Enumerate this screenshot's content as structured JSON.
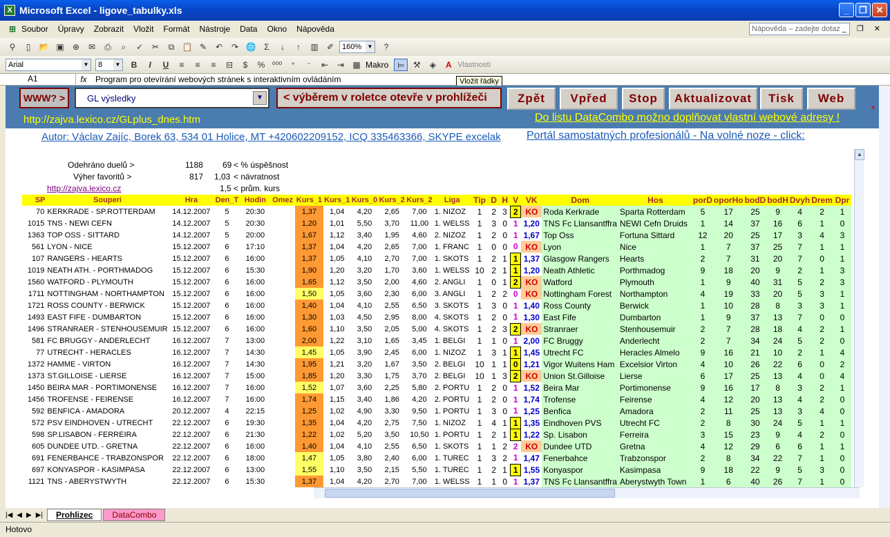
{
  "window": {
    "title": "Microsoft Excel - ligove_tabulky.xls",
    "icon": "excel-icon"
  },
  "menu": [
    "Soubor",
    "Úpravy",
    "Zobrazit",
    "Vložit",
    "Formát",
    "Nástroje",
    "Data",
    "Okno",
    "Nápověda"
  ],
  "help_placeholder": "Nápověda – zadejte dotaz",
  "toolbar": {
    "zoom": "160%",
    "font": "Arial",
    "size": "8",
    "bold": "B",
    "italic": "I",
    "underline": "U",
    "macro": "Makro",
    "properties": "Vlastnosti"
  },
  "formula": {
    "cell": "A1",
    "fx": "fx",
    "content": "Program pro otevírání webových stránek s interaktivním ovládáním"
  },
  "tooltip": "Vložit řádky",
  "controls": {
    "www_btn": "WWW? >",
    "dropdown_value": "GL výsledky",
    "hint": "< výběrem v roletce otevře v prohlížeči",
    "back": "Zpět",
    "forward": "Vpřed",
    "stop": "Stop",
    "refresh": "Aktualizovat",
    "print": "Tisk",
    "web": "Web",
    "url": "http://zajva.lexico.cz/GLplus_dnes.htm",
    "datacombo_note": "Do listu DataCombo možno doplňovat vlastní webové adresy !",
    "author": "Autor:  Václav Zajíc, Borek 63, 534 01 Holice, MT +420602209152, ICQ 335463366, SKYPE excelak",
    "portal": "Portál samostatných profesionálů - Na volné noze - click:"
  },
  "stats": {
    "played_label": "Odehráno duelů >",
    "played": "1188",
    "success_val": "69",
    "success_label": "< % úspěšnost",
    "fav_label": "Výher favoritů >",
    "fav": "817",
    "return_val": "1,03",
    "return_label": "< návratnost",
    "link": "http://zajva.lexico.cz",
    "avg_val": "1,5",
    "avg_label": "< prům. kurs"
  },
  "columns": [
    "SP",
    "Souperi",
    "Den_T",
    "Hodin",
    "Omez",
    "Kurs_1",
    "Kurs_1",
    "Kurs_0",
    "Kurs_2",
    "Kurs_2",
    "Liga",
    "Tip",
    "D",
    "H",
    "V",
    "VK",
    "Dom",
    "Hos",
    "porD",
    "oporH",
    "obodD",
    "bodH",
    "Dvyh",
    "Drem",
    "Dpr"
  ],
  "header_labels": {
    "sp": "SP",
    "souperi": "Souperi",
    "hra": "Hra",
    "dent": "Den_T",
    "hodin": "Hodin",
    "omez": "Omez",
    "k1": "Kurs_1",
    "k1b": "Kurs_1",
    "k0": "Kurs_0",
    "k2": "Kurs_2",
    "k2b": "Kurs_2",
    "liga": "Liga",
    "tip": "Tip",
    "d": "D",
    "h": "H",
    "v": "V",
    "vk": "VK",
    "dom": "Dom",
    "hos": "Hos",
    "pord": "porD",
    "opor": "oporHo",
    "bodd": "bodD",
    "bodh": "bodH",
    "dvyh": "Dvyh",
    "drem": "Drem",
    "dpr": "Dpr"
  },
  "rows": [
    [
      "70",
      "KERKRADE - SP.ROTTERDAM",
      "14.12.2007",
      "5",
      "20:30",
      "1,37",
      "1,04",
      "4,20",
      "2,65",
      "7,00",
      "1. NIZOZ",
      "1",
      "2",
      "3",
      "2",
      "KO",
      "Roda Kerkrade",
      "Sparta Rotterdam",
      "5",
      "17",
      "25",
      "9",
      "4",
      "2",
      "1"
    ],
    [
      "1015",
      "TNS - NEWI CEFN",
      "14.12.2007",
      "5",
      "20:30",
      "1,20",
      "1,01",
      "5,50",
      "3,70",
      "11,00",
      "1. WELSS",
      "1",
      "3",
      "0",
      "1",
      "1,20",
      "TNS Fc Llansantffra",
      "NEWI Cefn Druids",
      "1",
      "14",
      "37",
      "16",
      "6",
      "1",
      "0"
    ],
    [
      "1363",
      "TOP OSS - SITTARD",
      "14.12.2007",
      "5",
      "20:00",
      "1,67",
      "1,12",
      "3,40",
      "1,95",
      "4,60",
      "2. NIZOZ",
      "1",
      "2",
      "0",
      "1",
      "1,67",
      "Top Oss",
      "Fortuna Sittard",
      "12",
      "20",
      "25",
      "17",
      "3",
      "4",
      "3"
    ],
    [
      "561",
      "LYON - NICE",
      "15.12.2007",
      "6",
      "17:10",
      "1,37",
      "1,04",
      "4,20",
      "2,65",
      "7,00",
      "1. FRANC",
      "1",
      "0",
      "0",
      "0",
      "KO",
      "Lyon",
      "Nice",
      "1",
      "7",
      "37",
      "25",
      "7",
      "1",
      "1"
    ],
    [
      "107",
      "RANGERS - HEARTS",
      "15.12.2007",
      "6",
      "16:00",
      "1,37",
      "1,05",
      "4,10",
      "2,70",
      "7,00",
      "1. SKOTS",
      "1",
      "2",
      "1",
      "1",
      "1,37",
      "Glasgow Rangers",
      "Hearts",
      "2",
      "7",
      "31",
      "20",
      "7",
      "0",
      "1"
    ],
    [
      "1019",
      "NEATH ATH. - PORTHMADOG",
      "15.12.2007",
      "6",
      "15:30",
      "1,90",
      "1,20",
      "3,20",
      "1,70",
      "3,60",
      "1. WELSS",
      "10",
      "2",
      "1",
      "1",
      "1,20",
      "Neath Athletic",
      "Porthmadog",
      "9",
      "18",
      "20",
      "9",
      "2",
      "1",
      "3"
    ],
    [
      "1560",
      "WATFORD - PLYMOUTH",
      "15.12.2007",
      "6",
      "16:00",
      "1,65",
      "1,12",
      "3,50",
      "2,00",
      "4,60",
      "2. ANGLI",
      "1",
      "0",
      "1",
      "2",
      "KO",
      "Watford",
      "Plymouth",
      "1",
      "9",
      "40",
      "31",
      "5",
      "2",
      "3"
    ],
    [
      "1711",
      "NOTTINGHAM - NORTHAMPTON",
      "15.12.2007",
      "6",
      "16:00",
      "1,50",
      "1,05",
      "3,60",
      "2,30",
      "6,00",
      "3. ANGLI",
      "1",
      "2",
      "2",
      "0",
      "KO",
      "Nottingham Forest",
      "Northampton",
      "4",
      "19",
      "33",
      "20",
      "5",
      "3",
      "1"
    ],
    [
      "1721",
      "ROSS COUNTY - BERWICK",
      "15.12.2007",
      "6",
      "16:00",
      "1,40",
      "1,04",
      "4,10",
      "2,55",
      "6,50",
      "3. SKOTS",
      "1",
      "3",
      "0",
      "1",
      "1,40",
      "Ross County",
      "Berwick",
      "1",
      "10",
      "28",
      "8",
      "3",
      "3",
      "1"
    ],
    [
      "1493",
      "EAST FIFE - DUMBARTON",
      "15.12.2007",
      "6",
      "16:00",
      "1,30",
      "1,03",
      "4,50",
      "2,95",
      "8,00",
      "4. SKOTS",
      "1",
      "2",
      "0",
      "1",
      "1,30",
      "East Fife",
      "Dumbarton",
      "1",
      "9",
      "37",
      "13",
      "7",
      "0",
      "0"
    ],
    [
      "1496",
      "STRANRAER - STENHOUSEMUIR",
      "15.12.2007",
      "6",
      "16:00",
      "1,60",
      "1,10",
      "3,50",
      "2,05",
      "5,00",
      "4. SKOTS",
      "1",
      "2",
      "3",
      "2",
      "KO",
      "Stranraer",
      "Stenhousemuir",
      "2",
      "7",
      "28",
      "18",
      "4",
      "2",
      "1"
    ],
    [
      "581",
      "FC BRUGGY - ANDERLECHT",
      "16.12.2007",
      "7",
      "13:00",
      "2,00",
      "1,22",
      "3,10",
      "1,65",
      "3,45",
      "1. BELGI",
      "1",
      "1",
      "0",
      "1",
      "2,00",
      "FC Bruggy",
      "Anderlecht",
      "2",
      "7",
      "34",
      "24",
      "5",
      "2",
      "0"
    ],
    [
      "77",
      "UTRECHT - HERACLES",
      "16.12.2007",
      "7",
      "14:30",
      "1,45",
      "1,05",
      "3,90",
      "2,45",
      "6,00",
      "1. NIZOZ",
      "1",
      "3",
      "1",
      "1",
      "1,45",
      "Utrecht FC",
      "Heracles Almelo",
      "9",
      "16",
      "21",
      "10",
      "2",
      "1",
      "4"
    ],
    [
      "1372",
      "HAMME - VIRTON",
      "16.12.2007",
      "7",
      "14:30",
      "1,95",
      "1,21",
      "3,20",
      "1,67",
      "3,50",
      "2. BELGI",
      "10",
      "1",
      "1",
      "0",
      "1,21",
      "Vigor Wuitens Ham",
      "Excelsior Virton",
      "4",
      "10",
      "26",
      "22",
      "6",
      "0",
      "2"
    ],
    [
      "1373",
      "ST.GILLOISE - LIERSE",
      "16.12.2007",
      "7",
      "15:00",
      "1,85",
      "1,20",
      "3,30",
      "1,75",
      "3,70",
      "2. BELGI",
      "10",
      "1",
      "3",
      "2",
      "KO",
      "Union St.Gilloise",
      "Lierse",
      "6",
      "17",
      "25",
      "13",
      "4",
      "0",
      "4"
    ],
    [
      "1450",
      "BEIRA MAR - PORTIMONENSE",
      "16.12.2007",
      "7",
      "16:00",
      "1,52",
      "1,07",
      "3,60",
      "2,25",
      "5,80",
      "2. PORTU",
      "1",
      "2",
      "0",
      "1",
      "1,52",
      "Beira Mar",
      "Portimonense",
      "9",
      "16",
      "17",
      "8",
      "3",
      "2",
      "1"
    ],
    [
      "1456",
      "TROFENSE - FEIRENSE",
      "16.12.2007",
      "7",
      "16:00",
      "1,74",
      "1,15",
      "3,40",
      "1,86",
      "4,20",
      "2. PORTU",
      "1",
      "2",
      "0",
      "1",
      "1,74",
      "Trofense",
      "Feirense",
      "4",
      "12",
      "20",
      "13",
      "4",
      "2",
      "0"
    ],
    [
      "592",
      "BENFICA - AMADORA",
      "20.12.2007",
      "4",
      "22:15",
      "1,25",
      "1,02",
      "4,90",
      "3,30",
      "9,50",
      "1. PORTU",
      "1",
      "3",
      "0",
      "1",
      "1,25",
      "Benfica",
      "Amadora",
      "2",
      "11",
      "25",
      "13",
      "3",
      "4",
      "0"
    ],
    [
      "572",
      "PSV EINDHOVEN - UTRECHT",
      "22.12.2007",
      "6",
      "19:30",
      "1,35",
      "1,04",
      "4,20",
      "2,75",
      "7,50",
      "1. NIZOZ",
      "1",
      "4",
      "1",
      "1",
      "1,35",
      "Eindhoven PVS",
      "Utrecht FC",
      "2",
      "8",
      "30",
      "24",
      "5",
      "1",
      "1"
    ],
    [
      "598",
      "SP.LISABON - FERREIRA",
      "22.12.2007",
      "6",
      "21:30",
      "1,22",
      "1,02",
      "5,20",
      "3,50",
      "10,50",
      "1. PORTU",
      "1",
      "2",
      "1",
      "1",
      "1,22",
      "Sp. Lisabon",
      "Ferreira",
      "3",
      "15",
      "23",
      "9",
      "4",
      "2",
      "0"
    ],
    [
      "605",
      "DUNDEE UTD. - GRETNA",
      "22.12.2007",
      "6",
      "16:00",
      "1,40",
      "1,04",
      "4,10",
      "2,55",
      "6,50",
      "1. SKOTS",
      "1",
      "1",
      "2",
      "2",
      "KO",
      "Dundee UTD",
      "Gretna",
      "4",
      "12",
      "29",
      "6",
      "6",
      "1",
      "1"
    ],
    [
      "691",
      "FENERBAHCE - TRABZONSPOR",
      "22.12.2007",
      "6",
      "18:00",
      "1,47",
      "1,05",
      "3,80",
      "2,40",
      "6,00",
      "1. TUREC",
      "1",
      "3",
      "2",
      "1",
      "1,47",
      "Fenerbahce",
      "Trabzonspor",
      "2",
      "8",
      "34",
      "22",
      "7",
      "1",
      "0"
    ],
    [
      "697",
      "KONYASPOR - KASIMPASA",
      "22.12.2007",
      "6",
      "13:00",
      "1,55",
      "1,10",
      "3,50",
      "2,15",
      "5,50",
      "1. TUREC",
      "1",
      "2",
      "1",
      "1",
      "1,55",
      "Konyaspor",
      "Kasimpasa",
      "9",
      "18",
      "22",
      "9",
      "5",
      "3",
      "0"
    ],
    [
      "1121",
      "TNS - ABERYSTWYTH",
      "22.12.2007",
      "6",
      "15:30",
      "1,37",
      "1,04",
      "4,20",
      "2,70",
      "7,00",
      "1. WELSS",
      "1",
      "1",
      "0",
      "1",
      "1,37",
      "TNS Fc Llansantffra",
      "Aberystwyth Town",
      "1",
      "6",
      "40",
      "26",
      "7",
      "1",
      "0"
    ]
  ],
  "sheets": [
    "Prohlizec",
    "DataCombo"
  ],
  "status": "Hotovo",
  "colors": {
    "band": "#4b7cb0",
    "header_yellow": "#ffff00",
    "team_green": "#ccffcc",
    "ko_red": "#cc0000",
    "vk_blue": "#0000cc"
  }
}
